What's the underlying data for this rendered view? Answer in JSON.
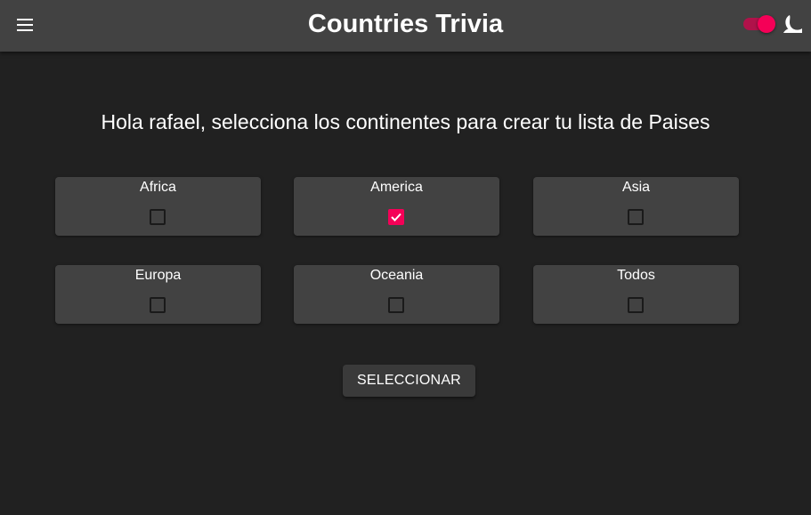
{
  "app": {
    "title": "Countries Trivia",
    "menu_icon": "menu-icon",
    "theme_icon": "moon-icon",
    "dark_mode_on": true,
    "accent_color": "#f50057"
  },
  "main": {
    "greeting": "Hola rafael, selecciona los continentes para crear tu lista de Paises",
    "continents": [
      {
        "label": "Africa",
        "checked": false
      },
      {
        "label": "America",
        "checked": true
      },
      {
        "label": "Asia",
        "checked": false
      },
      {
        "label": "Europa",
        "checked": false
      },
      {
        "label": "Oceania",
        "checked": false
      },
      {
        "label": "Todos",
        "checked": false
      }
    ],
    "select_label": "SELECCIONAR"
  }
}
